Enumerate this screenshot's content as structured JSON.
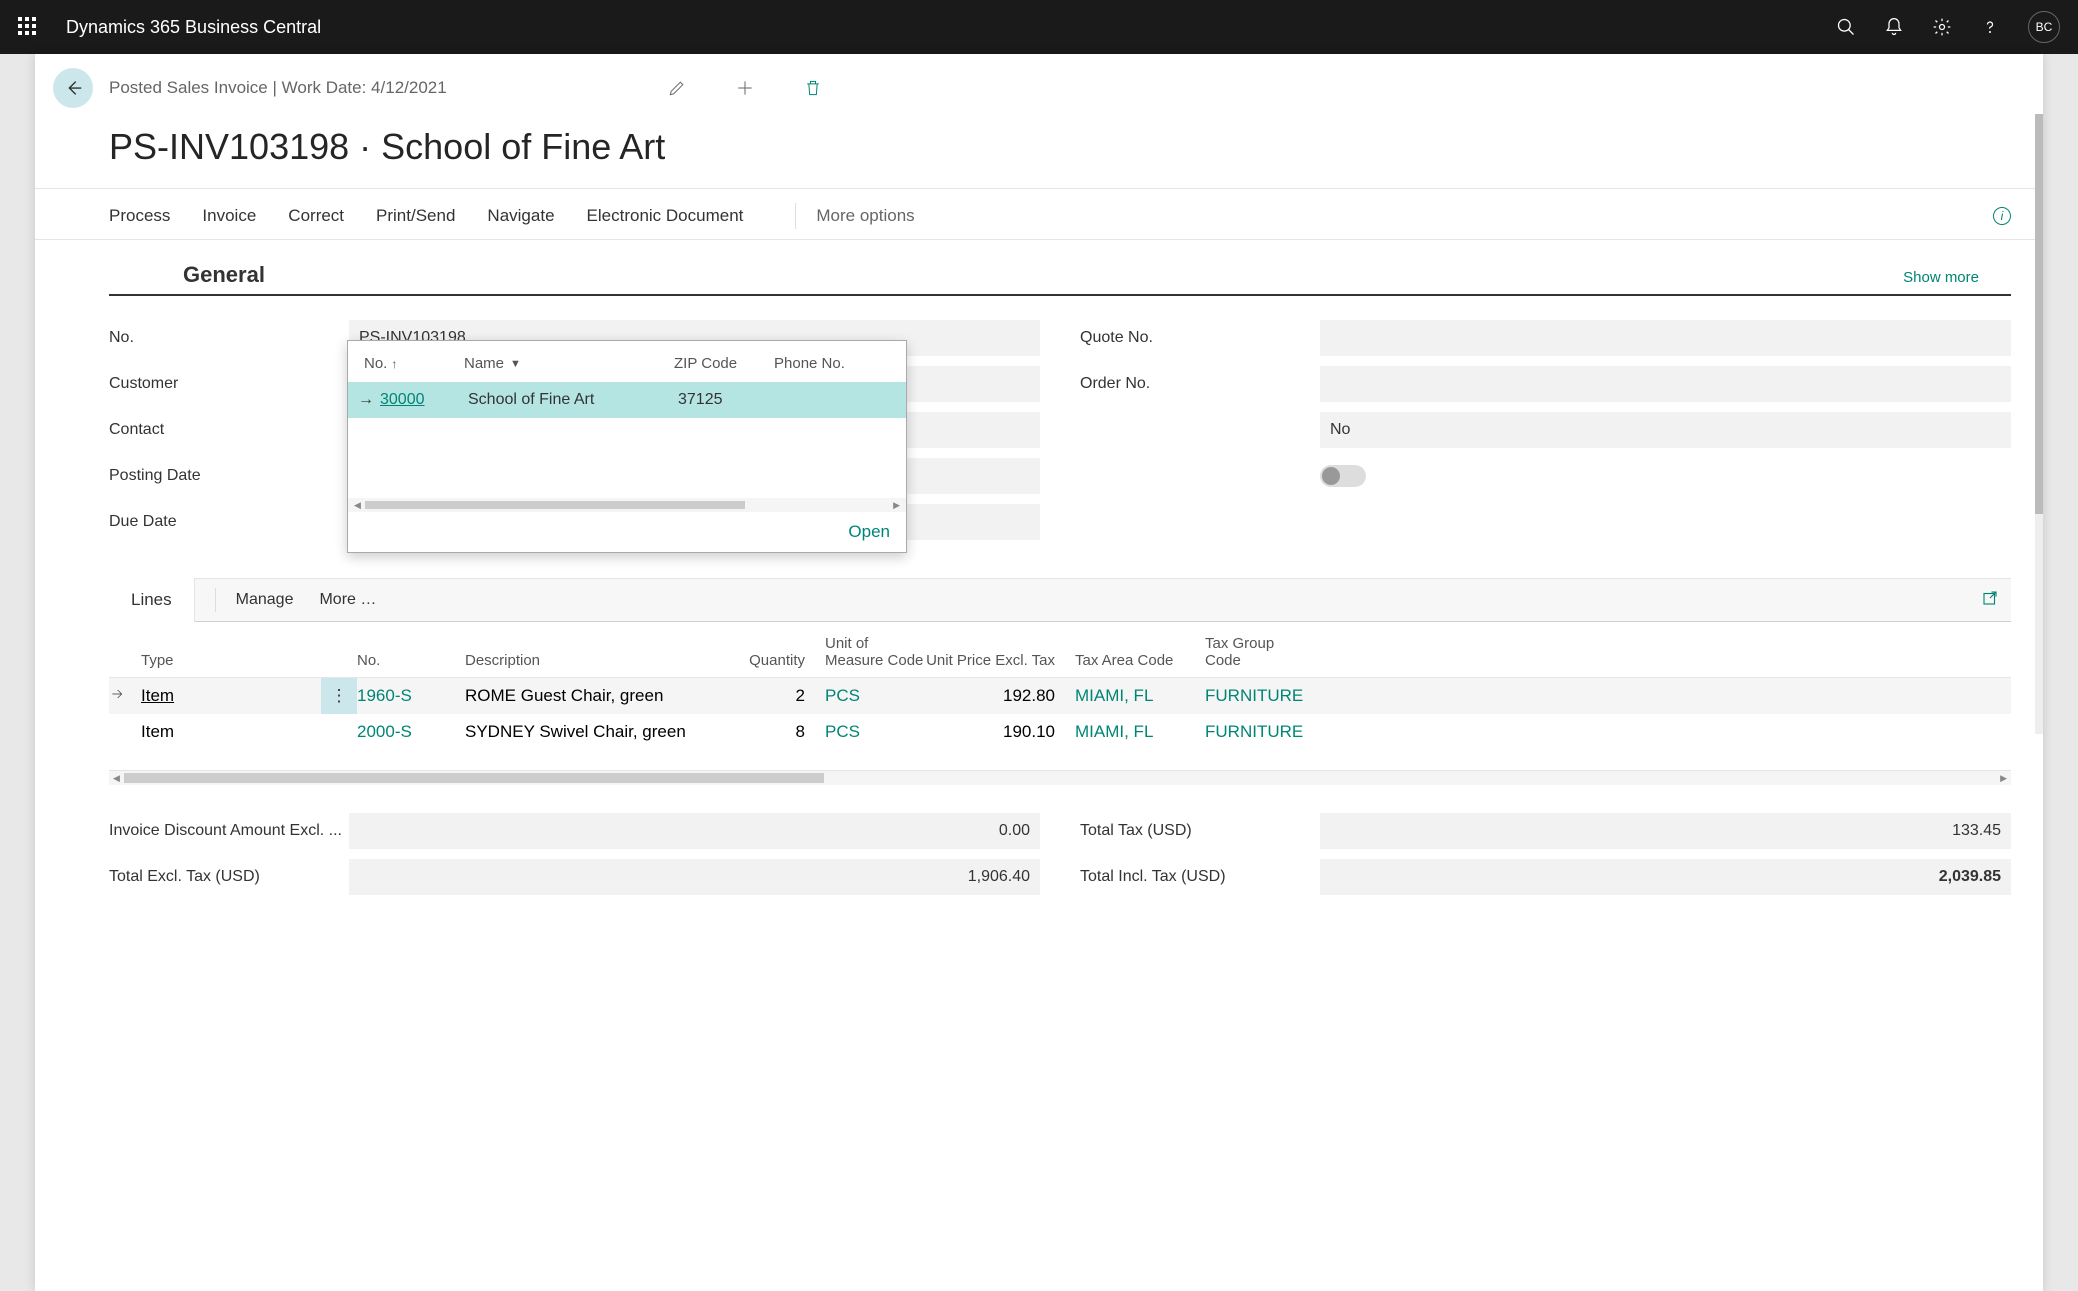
{
  "app_title": "Dynamics 365 Business Central",
  "user_initials": "BC",
  "breadcrumb": "Posted Sales Invoice | Work Date: 4/12/2021",
  "page_title": "PS-INV103198 · School of Fine Art",
  "tabs": [
    "Process",
    "Invoice",
    "Correct",
    "Print/Send",
    "Navigate",
    "Electronic Document"
  ],
  "more_options": "More options",
  "section_general": "General",
  "show_more": "Show more",
  "fields_left": {
    "no_label": "No.",
    "no_value": "PS-INV103198",
    "customer_label": "Customer",
    "customer_value": "School of Fine Art",
    "contact_label": "Contact",
    "posting_label": "Posting Date",
    "due_label": "Due Date"
  },
  "fields_right": {
    "quote_label": "Quote No.",
    "order_label": "Order No.",
    "closed_value": "No"
  },
  "lookup": {
    "col_no": "No.",
    "col_name": "Name",
    "col_zip": "ZIP Code",
    "col_phone": "Phone No.",
    "row_no": "30000",
    "row_name": "School of Fine Art",
    "row_zip": "37125",
    "open": "Open"
  },
  "lines": {
    "tab": "Lines",
    "manage": "Manage",
    "more": "More options",
    "cols": {
      "type": "Type",
      "no": "No.",
      "desc": "Description",
      "qty": "Quantity",
      "uom": "Unit of Measure Code",
      "price": "Unit Price Excl. Tax",
      "taxarea": "Tax Area Code",
      "taxgrp": "Tax Group Code"
    },
    "rows": [
      {
        "type": "Item",
        "no": "1960-S",
        "desc": "ROME Guest Chair, green",
        "qty": "2",
        "uom": "PCS",
        "price": "192.80",
        "taxarea": "MIAMI, FL",
        "taxgrp": "FURNITURE"
      },
      {
        "type": "Item",
        "no": "2000-S",
        "desc": "SYDNEY Swivel Chair, green",
        "qty": "8",
        "uom": "PCS",
        "price": "190.10",
        "taxarea": "MIAMI, FL",
        "taxgrp": "FURNITURE"
      }
    ]
  },
  "totals": {
    "discount_label": "Invoice Discount Amount Excl. ...",
    "discount_value": "0.00",
    "excl_label": "Total Excl. Tax (USD)",
    "excl_value": "1,906.40",
    "tax_label": "Total Tax (USD)",
    "tax_value": "133.45",
    "incl_label": "Total Incl. Tax (USD)",
    "incl_value": "2,039.85"
  }
}
